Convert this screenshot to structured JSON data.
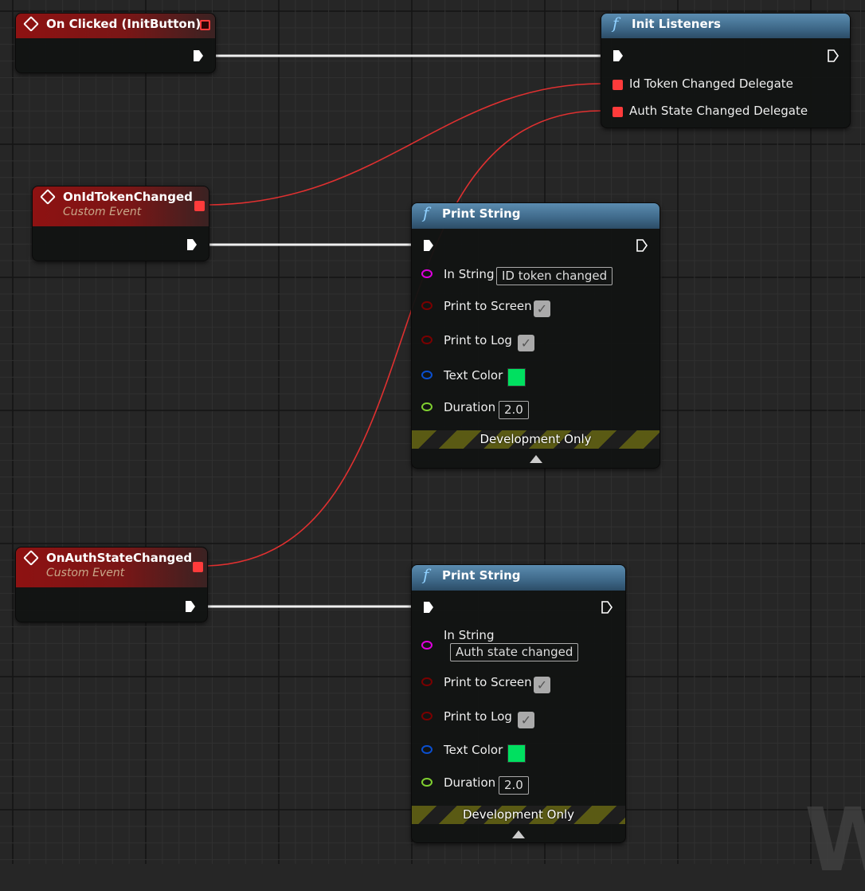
{
  "nodes": {
    "on_clicked": {
      "title": "On Clicked (InitButton)"
    },
    "init_listeners": {
      "title": "Init Listeners",
      "pins": [
        "Id Token Changed Delegate",
        "Auth State Changed Delegate"
      ]
    },
    "on_id_token": {
      "title": "OnIdTokenChanged",
      "subtitle": "Custom Event"
    },
    "on_auth_state": {
      "title": "OnAuthStateChanged",
      "subtitle": "Custom Event"
    },
    "print1": {
      "title": "Print String",
      "in_string_label": "In String",
      "in_string": "ID token changed",
      "print_screen": "Print to Screen",
      "print_log": "Print to Log",
      "text_color": "Text Color",
      "duration_label": "Duration",
      "duration": "2.0",
      "dev_only": "Development Only"
    },
    "print2": {
      "title": "Print String",
      "in_string_label": "In String",
      "in_string": "Auth state changed",
      "print_screen": "Print to Screen",
      "print_log": "Print to Log",
      "text_color": "Text Color",
      "duration_label": "Duration",
      "duration": "2.0",
      "dev_only": "Development Only"
    }
  },
  "colors": {
    "exec": "#ffffff",
    "delegate": "#ff3b3b",
    "string": "#e000e0",
    "bool": "#8a0000",
    "color": "#0a4fd0",
    "float": "#80d030",
    "text_color_value": "#00e060"
  },
  "watermark": "W"
}
